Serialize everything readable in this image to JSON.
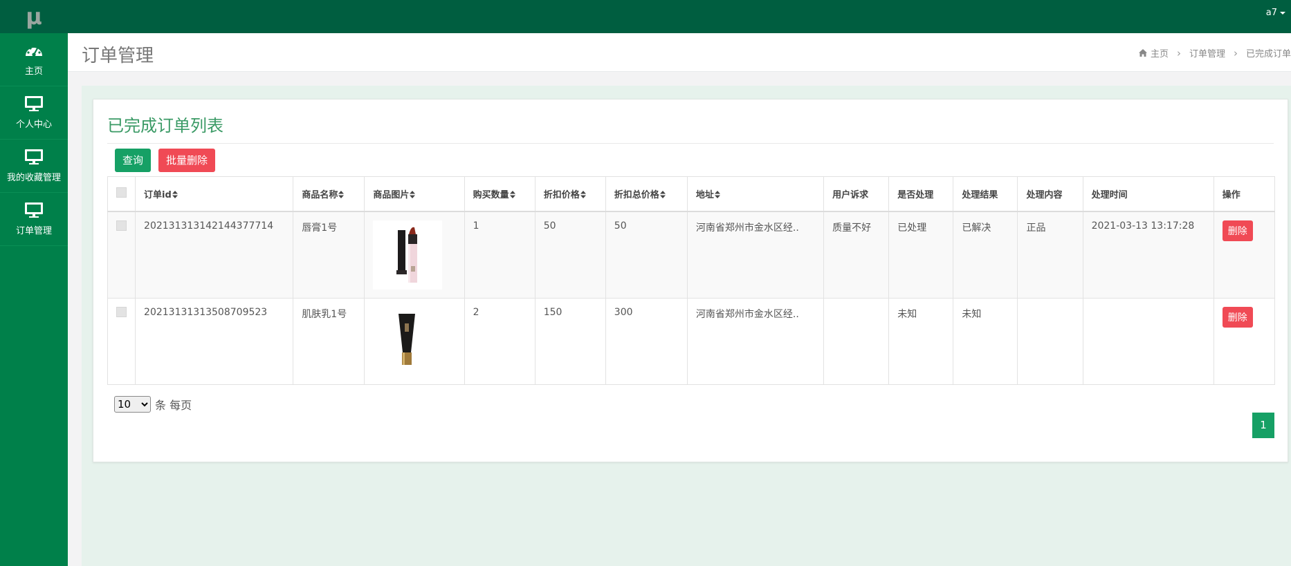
{
  "app": {
    "logo": "μ",
    "user": "a7"
  },
  "sidebar": {
    "items": [
      {
        "label": "主页",
        "icon": "dashboard-icon"
      },
      {
        "label": "个人中心",
        "icon": "monitor-icon"
      },
      {
        "label": "我的收藏管理",
        "icon": "monitor-icon"
      },
      {
        "label": "订单管理",
        "icon": "monitor-icon"
      }
    ]
  },
  "header": {
    "title": "订单管理",
    "breadcrumb": [
      "主页",
      "订单管理",
      "已完成订单"
    ]
  },
  "panel": {
    "title": "已完成订单列表",
    "query_label": "查询",
    "batch_delete_label": "批量删除"
  },
  "table": {
    "columns": [
      "订单id",
      "商品名称",
      "商品图片",
      "购买数量",
      "折扣价格",
      "折扣总价格",
      "地址",
      "用户诉求",
      "是否处理",
      "处理结果",
      "处理内容",
      "处理时间",
      "操作"
    ],
    "rows": [
      {
        "order_id": "202131313142144377714",
        "product": "唇膏1号",
        "image": "lipstick",
        "qty": "1",
        "price": "50",
        "total": "50",
        "address": "河南省郑州市金水区经..",
        "appeal": "质量不好",
        "processed": "已处理",
        "result": "已解决",
        "content": "正品",
        "time": "2021-03-13 13:17:28",
        "action": "删除"
      },
      {
        "order_id": "202131313135087095​23",
        "product": "肌肤乳1号",
        "image": "lotion-tube",
        "qty": "2",
        "price": "150",
        "total": "300",
        "address": "河南省郑州市金水区经..",
        "appeal": "",
        "processed": "未知",
        "result": "未知",
        "content": "",
        "time": "",
        "action": "删除"
      }
    ]
  },
  "pagination": {
    "page_size": "10",
    "page_size_suffix": "条 每页",
    "current_page": "1"
  },
  "colors": {
    "sidebar": "#00804a",
    "topbar": "#005e40",
    "accent": "#16a065",
    "danger": "#f04a55",
    "title_green": "#3a9a65"
  }
}
